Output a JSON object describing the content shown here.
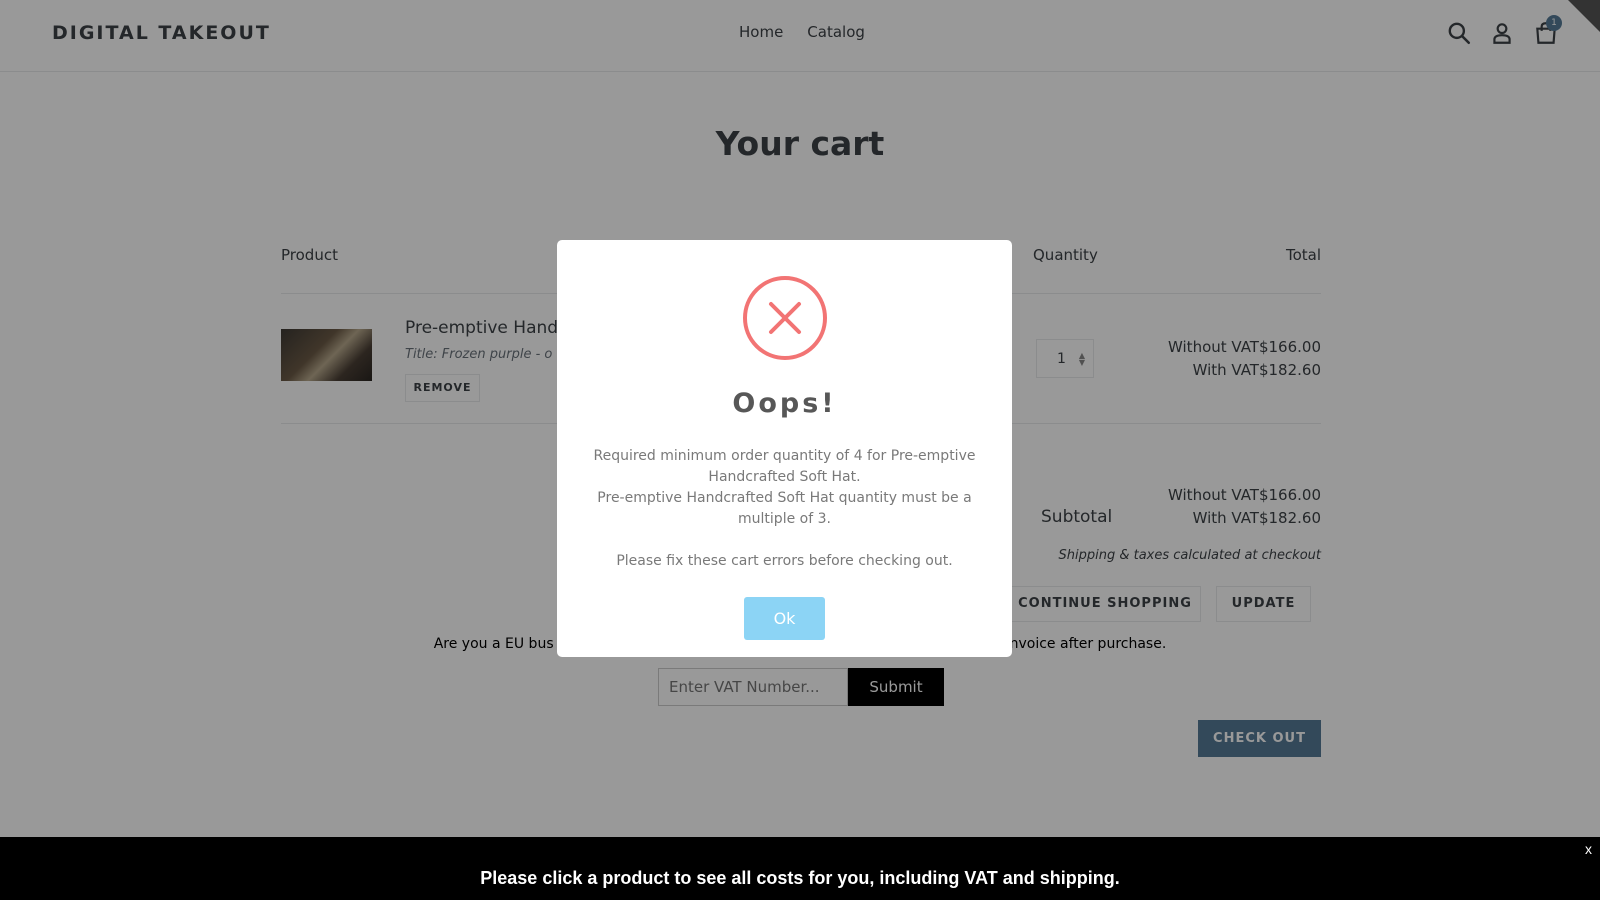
{
  "header": {
    "logo": "DIGITAL TAKEOUT",
    "nav": [
      "Home",
      "Catalog"
    ],
    "cart_count": "1",
    "icons": [
      "search-icon",
      "account-icon",
      "cart-icon"
    ]
  },
  "cart": {
    "title": "Your cart",
    "columns": {
      "product": "Product",
      "quantity": "Quantity",
      "total": "Total"
    },
    "item": {
      "name": "Pre-emptive Hand",
      "variant": "Title: Frozen purple - o",
      "remove_label": "REMOVE",
      "quantity": "1",
      "total_without_vat": "Without VAT$166.00",
      "total_with_vat": "With VAT$182.60"
    },
    "subtotal_label": "Subtotal",
    "subtotal_without_vat": "Without VAT$166.00",
    "subtotal_with_vat": "With VAT$182.60",
    "shipping_note": "Shipping & taxes calculated at checkout",
    "continue_label": "CONTINUE SHOPPING",
    "update_label": "UPDATE",
    "vat_question_left": "Are you a EU bus",
    "vat_question_right": "nvoice after purchase.",
    "vat_placeholder": "Enter VAT Number...",
    "vat_submit": "Submit",
    "checkout_label": "CHECK OUT"
  },
  "modal": {
    "icon": "error-x-icon",
    "title": "Oops!",
    "line1": "Required minimum order quantity of 4 for Pre-emptive Handcrafted Soft Hat.",
    "line2": "Pre-emptive Handcrafted Soft Hat quantity must be a multiple of 3.",
    "line3": "Please fix these cart errors before checking out.",
    "ok_label": "Ok"
  },
  "bottom_bar": {
    "message": "Please click a product to see all costs for you, including VAT and shipping.",
    "close_label": "x"
  },
  "colors": {
    "accent": "#557b97",
    "error": "#f27474",
    "ok_button": "#8cd4f5"
  }
}
